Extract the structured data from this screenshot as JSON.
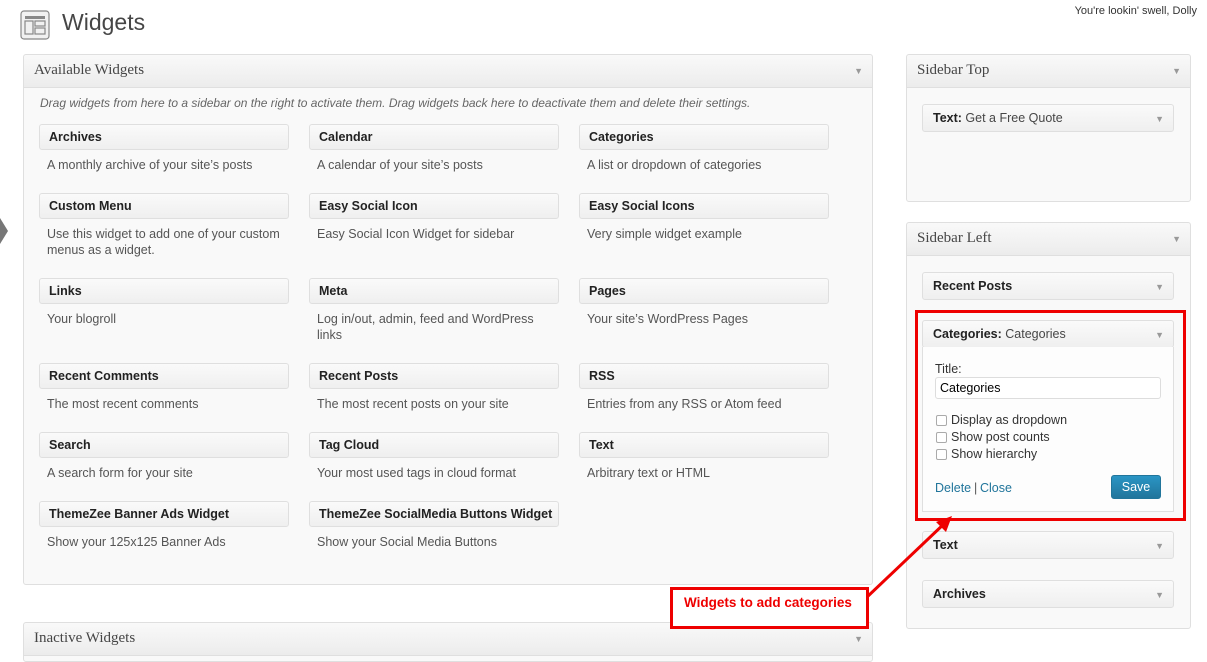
{
  "header": {
    "title": "Widgets",
    "howdy": "You're lookin' swell, Dolly"
  },
  "available": {
    "title": "Available Widgets",
    "help": "Drag widgets from here to a sidebar on the right to activate them. Drag widgets back here to deactivate them and delete their settings.",
    "widgets": [
      {
        "name": "Archives",
        "desc": "A monthly archive of your site’s posts"
      },
      {
        "name": "Calendar",
        "desc": "A calendar of your site’s posts"
      },
      {
        "name": "Categories",
        "desc": "A list or dropdown of categories"
      },
      {
        "name": "Custom Menu",
        "desc": "Use this widget to add one of your custom menus as a widget."
      },
      {
        "name": "Easy Social Icon",
        "desc": "Easy Social Icon Widget for sidebar"
      },
      {
        "name": "Easy Social Icons",
        "desc": "Very simple widget example"
      },
      {
        "name": "Links",
        "desc": "Your blogroll"
      },
      {
        "name": "Meta",
        "desc": "Log in/out, admin, feed and WordPress links"
      },
      {
        "name": "Pages",
        "desc": "Your site’s WordPress Pages"
      },
      {
        "name": "Recent Comments",
        "desc": "The most recent comments"
      },
      {
        "name": "Recent Posts",
        "desc": "The most recent posts on your site"
      },
      {
        "name": "RSS",
        "desc": "Entries from any RSS or Atom feed"
      },
      {
        "name": "Search",
        "desc": "A search form for your site"
      },
      {
        "name": "Tag Cloud",
        "desc": "Your most used tags in cloud format"
      },
      {
        "name": "Text",
        "desc": "Arbitrary text or HTML"
      },
      {
        "name": "ThemeZee Banner Ads Widget",
        "desc": "Show your 125x125 Banner Ads"
      },
      {
        "name": "ThemeZee SocialMedia Buttons Widget",
        "desc": "Show your Social Media Buttons"
      }
    ]
  },
  "inactive": {
    "title": "Inactive Widgets"
  },
  "sidebar_top": {
    "title": "Sidebar Top",
    "widget": {
      "type": "Text:",
      "title": "Get a Free Quote"
    }
  },
  "sidebar_left": {
    "title": "Sidebar Left",
    "recent_posts": "Recent Posts",
    "categories_widget": {
      "type": "Categories:",
      "title": "Categories",
      "title_label": "Title:",
      "title_value": "Categories",
      "opt_dropdown": "Display as dropdown",
      "opt_counts": "Show post counts",
      "opt_hierarchy": "Show hierarchy",
      "delete": "Delete",
      "sep": "|",
      "close": "Close",
      "save": "Save"
    },
    "text": "Text",
    "archives": "Archives"
  },
  "annotation": {
    "label": "Widgets to add categories"
  },
  "colors": {
    "accent_red": "#ee0000",
    "link": "#21759b",
    "button": "#21759b"
  }
}
